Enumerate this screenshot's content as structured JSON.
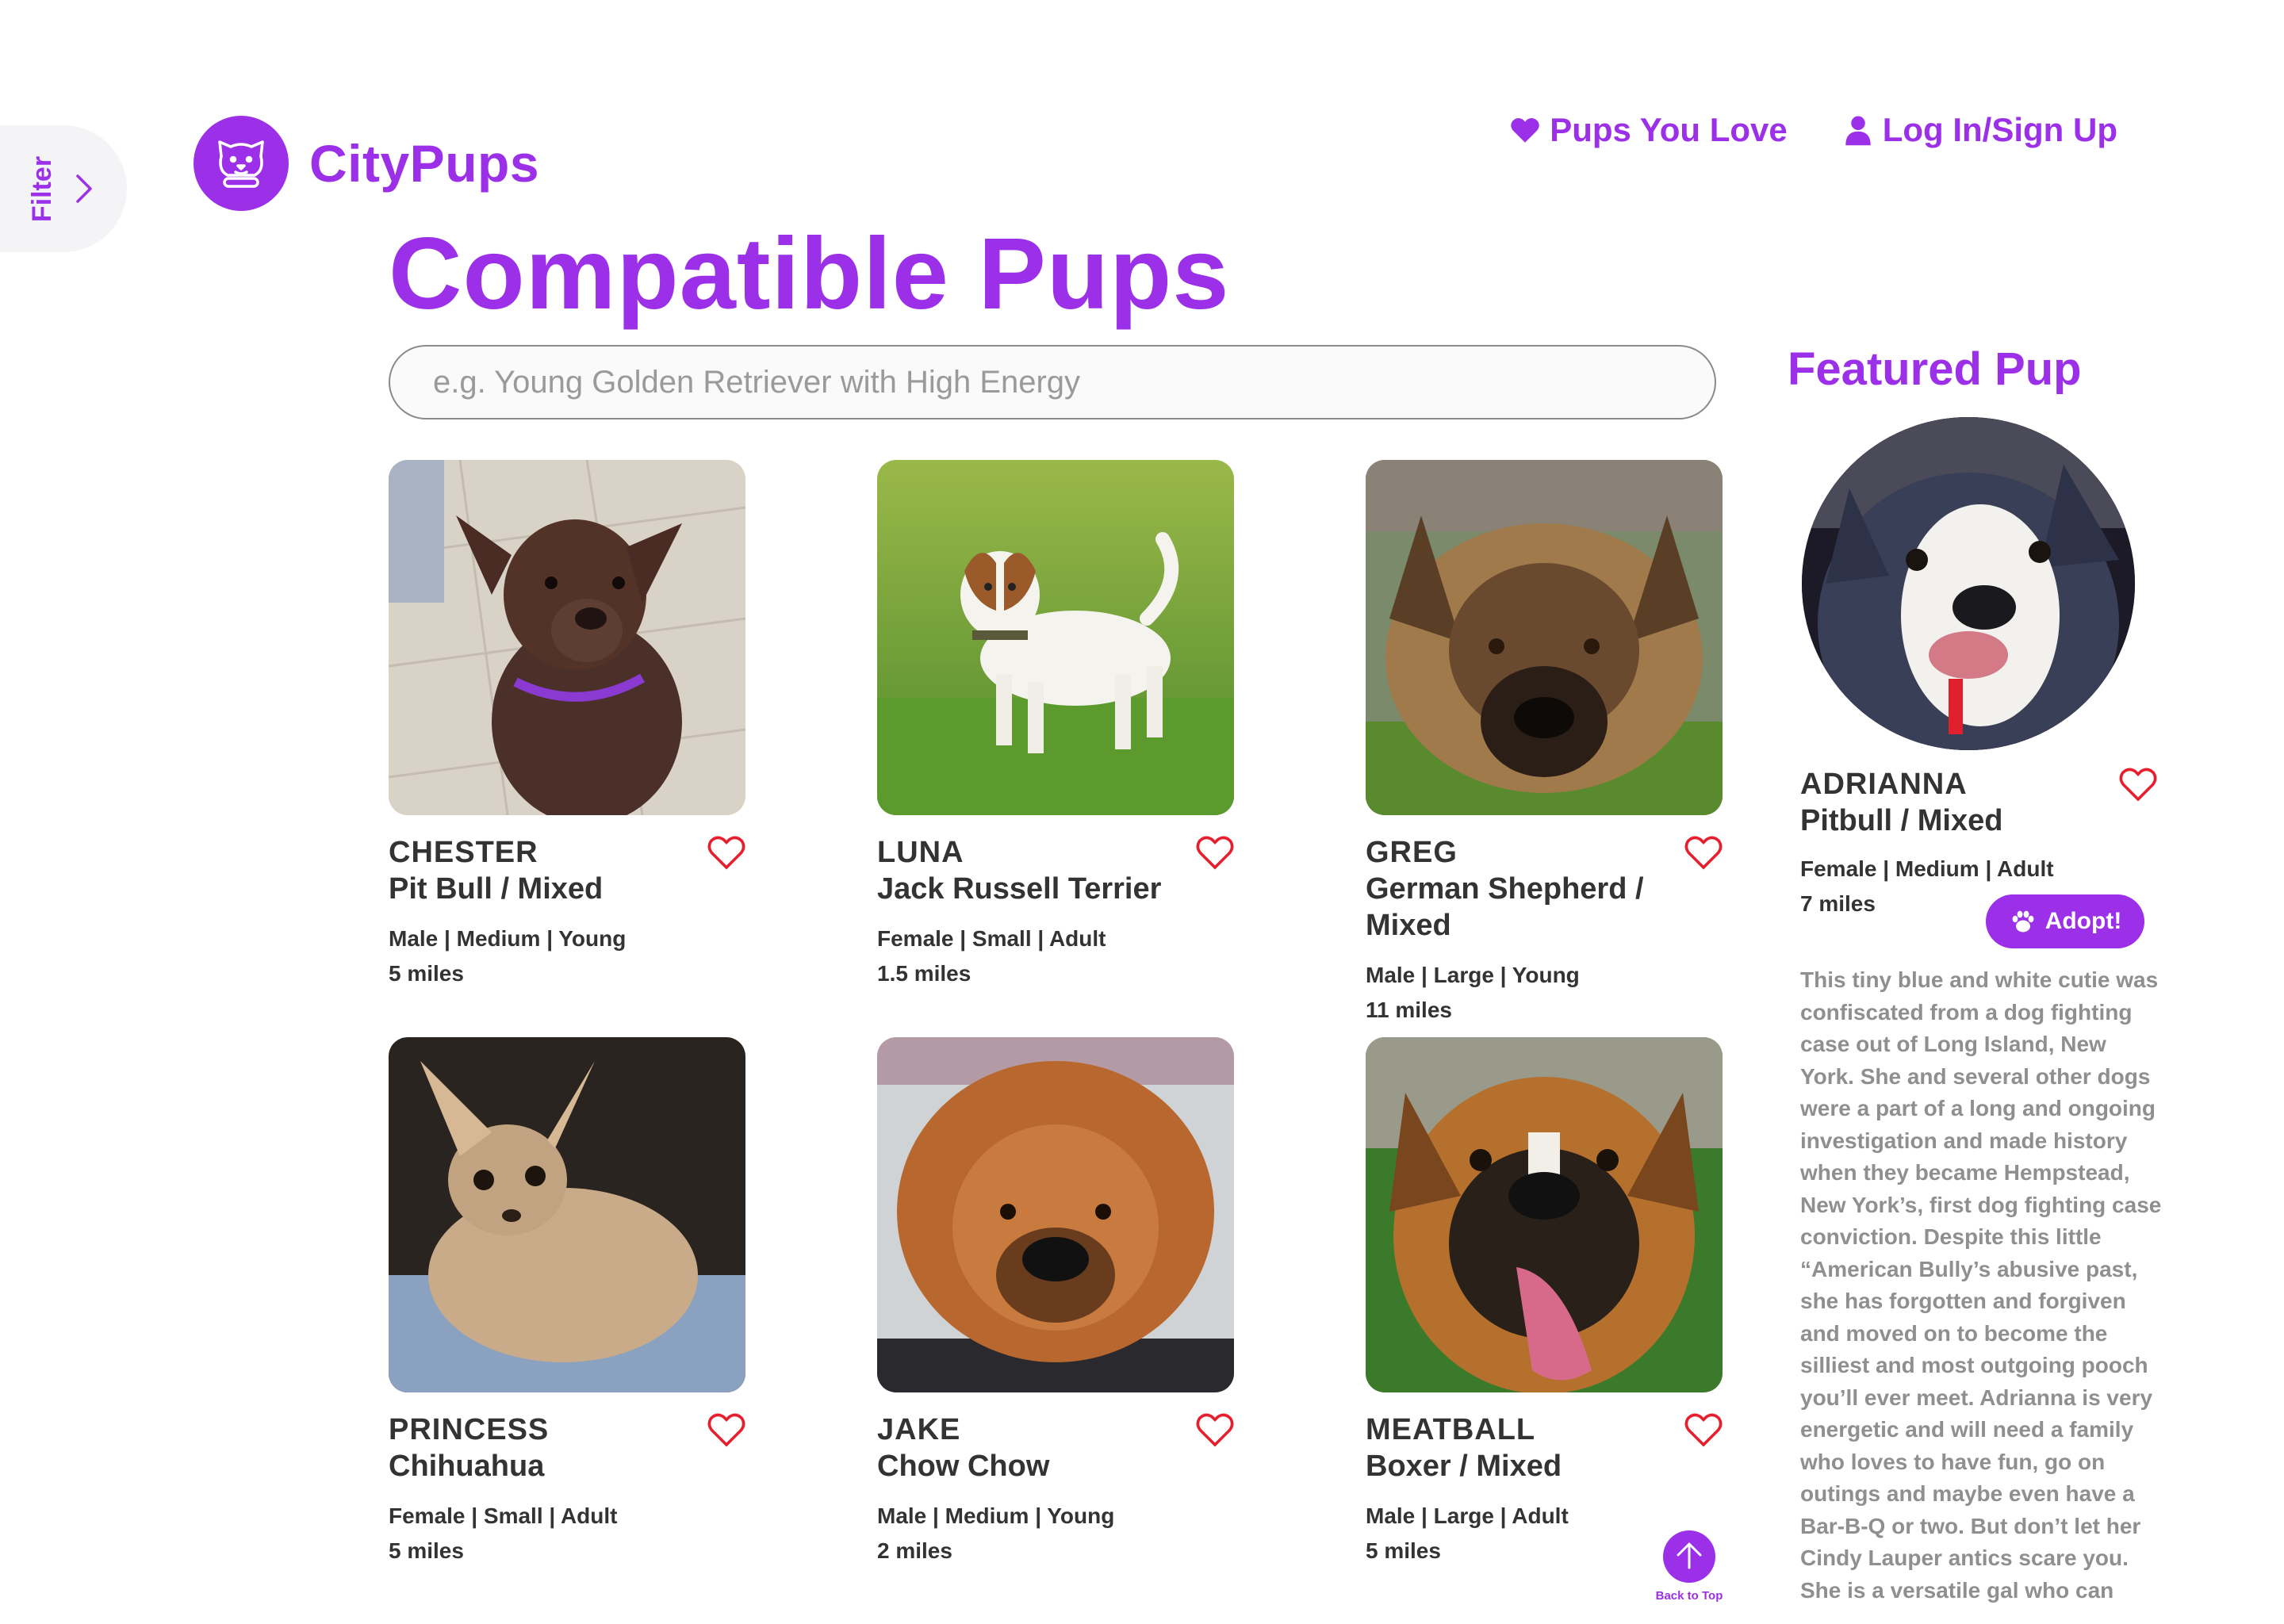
{
  "brand": {
    "name": "CityPups",
    "accent": "#9b30e8",
    "heart_color": "#e81e2c"
  },
  "filter_tab": {
    "label": "Filter",
    "icon": "chevron-right-icon"
  },
  "nav": {
    "favorites": {
      "label": "Pups You Love",
      "icon": "heart-icon"
    },
    "account": {
      "label": "Log In/Sign Up",
      "icon": "user-icon"
    }
  },
  "page_title": "Compatible Pups",
  "search": {
    "placeholder": "e.g. Young Golden Retriever with High Energy",
    "value": ""
  },
  "pups": [
    {
      "name": "CHESTER",
      "breed": "Pit Bull / Mixed",
      "stats": "Male | Medium | Young",
      "distance": "5 miles"
    },
    {
      "name": "LUNA",
      "breed": "Jack Russell Terrier",
      "stats": "Female | Small | Adult",
      "distance": "1.5 miles"
    },
    {
      "name": "GREG",
      "breed": "German Shepherd / Mixed",
      "stats": "Male | Large | Young",
      "distance": "11 miles"
    },
    {
      "name": "PRINCESS",
      "breed": "Chihuahua",
      "stats": "Female | Small | Adult",
      "distance": "5 miles"
    },
    {
      "name": "JAKE",
      "breed": "Chow Chow",
      "stats": "Male | Medium | Young",
      "distance": "2 miles"
    },
    {
      "name": "MEATBALL",
      "breed": "Boxer / Mixed",
      "stats": "Male | Large | Adult",
      "distance": "5 miles"
    }
  ],
  "featured": {
    "heading": "Featured Pup",
    "name": "ADRIANNA",
    "breed": "Pitbull / Mixed",
    "stats": "Female | Medium | Adult",
    "distance": "7 miles",
    "adopt_label": "Adopt!",
    "description": "This tiny blue and white cutie was confiscated from a dog fighting case out of Long Island, New York. She and several other dogs were a part of a long and ongoing investigation and made history when they became Hempstead, New York’s, first dog fighting case conviction. Despite this little “American Bully’s abusive past, she has forgotten and forgiven and moved on to become the silliest and most outgoing pooch you’ll ever meet. Adrianna is very energetic and will need a family who loves to have fun, go on outings and maybe even have a Bar-B-Q or two. But don’t let her Cindy Lauper antics scare you. She is a versatile gal who can"
  },
  "back_to_top": {
    "label": "Back to Top",
    "icon": "arrow-up-icon"
  }
}
